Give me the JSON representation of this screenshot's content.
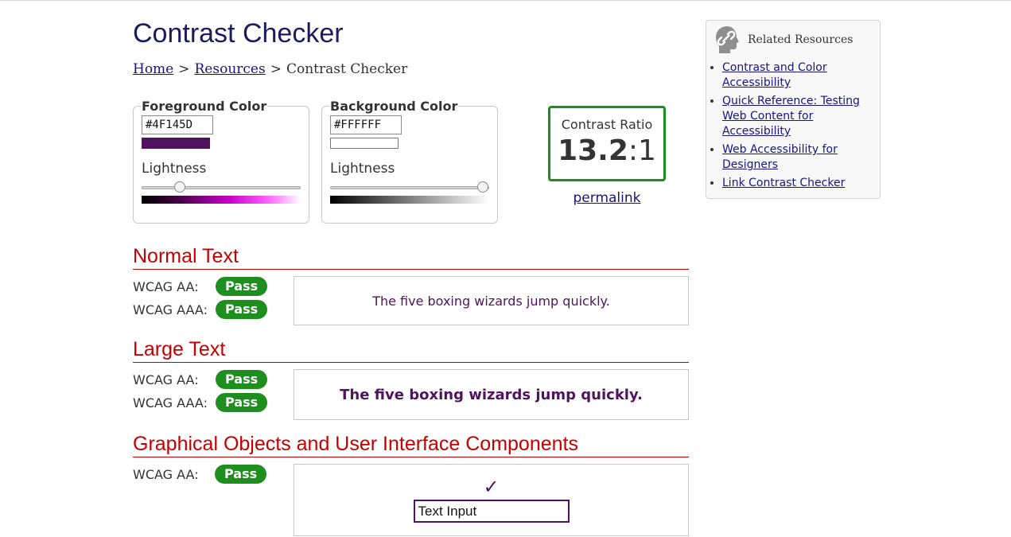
{
  "page": {
    "title": "Contrast Checker"
  },
  "breadcrumb": {
    "home": "Home",
    "sep1": ">",
    "resources": "Resources",
    "sep2": ">",
    "current": "Contrast Checker"
  },
  "foreground": {
    "legend": "Foreground Color",
    "hex": "#4F145D",
    "lightness_label": "Lightness",
    "lightness_level": 0.24,
    "swatch_color": "#4F145D"
  },
  "background": {
    "legend": "Background Color",
    "hex": "#FFFFFF",
    "lightness_label": "Lightness",
    "lightness_level": 0.96,
    "swatch_color": "#FFFFFF"
  },
  "ratio": {
    "label": "Contrast Ratio",
    "value": "13.2",
    "suffix": ":1",
    "permalink": "permalink"
  },
  "sections": {
    "normal": {
      "heading": "Normal Text",
      "aa_label": "WCAG AA:",
      "aa_result": "Pass",
      "aaa_label": "WCAG AAA:",
      "aaa_result": "Pass",
      "sample": "The five boxing wizards jump quickly."
    },
    "large": {
      "heading": "Large Text",
      "aa_label": "WCAG AA:",
      "aa_result": "Pass",
      "aaa_label": "WCAG AAA:",
      "aaa_result": "Pass",
      "sample": "The five boxing wizards jump quickly."
    },
    "graphical": {
      "heading": "Graphical Objects and User Interface Components",
      "aa_label": "WCAG AA:",
      "aa_result": "Pass",
      "checkmark": "✓",
      "input_value": "Text Input"
    }
  },
  "sidebar": {
    "title": "Related Resources",
    "icon": "link-icon",
    "links": [
      "Contrast and Color Accessibility",
      "Quick Reference: Testing Web Content for Accessibility",
      "Web Accessibility for Designers",
      "Link Contrast Checker"
    ]
  },
  "colors": {
    "foreground": "#4F145D",
    "background": "#FFFFFF",
    "pass": "#1E8E1E",
    "heading_red": "#C40000",
    "title_navy": "#1F1A5E",
    "link": "#1A1380"
  }
}
